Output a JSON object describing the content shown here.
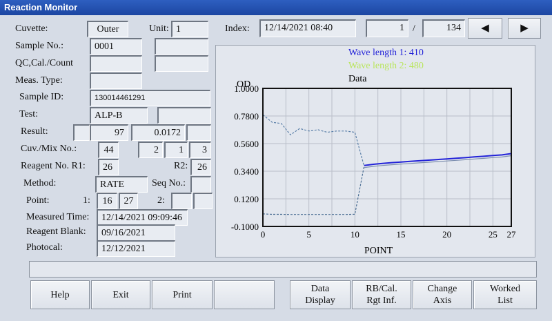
{
  "window": {
    "title": "Reaction Monitor"
  },
  "labels": {
    "cuvette": "Cuvette:",
    "unit": "Unit:",
    "index": "Index:",
    "sample_no": "Sample No.:",
    "qc": "QC,Cal./Count",
    "meas_type": "Meas. Type:",
    "sample_id": "Sample ID:",
    "test": "Test:",
    "result": "Result:",
    "cuv_mix": "Cuv./Mix No.:",
    "reagent_no": "Reagent No.  R1:",
    "r2": "R2:",
    "method": "Method:",
    "seq_no": "Seq No.:",
    "point": "Point:",
    "point_1": "1:",
    "point_2": "2:",
    "measured_time": "Measured Time:",
    "reagent_blank": "Reagent Blank:",
    "photocal": "Photocal:",
    "index_sep": "/"
  },
  "fields": {
    "cuvette": "Outer",
    "unit": "1",
    "index_datetime": "12/14/2021 08:40",
    "index_current": "1",
    "index_total": "134",
    "sample_no": "0001",
    "sample_no_extra": "",
    "qc_value": "",
    "qc_extra": "",
    "meas_type": "",
    "sample_id": "130014461291",
    "test": "ALP-B",
    "test_extra": "",
    "result_flag": "",
    "result_value": "97",
    "result_od": "0.0172",
    "result_extra": "",
    "cuv_no": "44",
    "mix_a": "2",
    "mix_b": "1",
    "mix_c": "3",
    "r1": "26",
    "r2": "26",
    "method": "RATE",
    "seq_no": "",
    "point1_start": "16",
    "point1_end": "27",
    "point2_start": "",
    "point2_end": "",
    "measured_time": "12/14/2021  09:09:46",
    "reagent_blank": "09/16/2021",
    "photocal": "12/12/2021"
  },
  "nav": {
    "prev_icon": "triangle-left-icon",
    "next_icon": "triangle-right-icon",
    "prev": "◀",
    "next": "▶"
  },
  "buttons": {
    "help": "Help",
    "exit": "Exit",
    "print": "Print",
    "blank": "",
    "data_display": "Data\nDisplay",
    "rb_cal": "RB/Cal.\nRgt Inf.",
    "change_axis": "Change\nAxis",
    "worked_list": "Worked\nList"
  },
  "status_text": "",
  "colors": {
    "wave1": "#2323d8",
    "wave2": "#b9e65c",
    "titlebar": "#1c46a2"
  },
  "chart_data": {
    "type": "line",
    "legend": [
      "Wave length 1: 410",
      "Wave length 2: 480",
      "Data"
    ],
    "ylabel": "OD",
    "xlabel": "POINT",
    "x_ticks": [
      0,
      5,
      10,
      15,
      20,
      25,
      27
    ],
    "y_ticks": [
      "1.0000",
      "0.7800",
      "0.5600",
      "0.3400",
      "0.1200",
      "-0.1000"
    ],
    "xlim": [
      0,
      27
    ],
    "ylim": [
      -0.1,
      1.0
    ],
    "grid": true,
    "series": [
      {
        "name": "Wave length 1: 410",
        "style": "dotted",
        "x": [
          0,
          1,
          2,
          3,
          4,
          5,
          6,
          7,
          8,
          9,
          10,
          11
        ],
        "y": [
          0.79,
          0.73,
          0.72,
          0.63,
          0.68,
          0.66,
          0.67,
          0.65,
          0.66,
          0.66,
          0.65,
          0.38
        ]
      },
      {
        "name": "Wave length 2: 480",
        "style": "dotted",
        "x": [
          0,
          1,
          2,
          3,
          4,
          5,
          6,
          7,
          8,
          9,
          10,
          11
        ],
        "y": [
          0.0,
          -0.004,
          -0.004,
          -0.005,
          -0.005,
          -0.005,
          -0.005,
          -0.005,
          -0.005,
          -0.005,
          -0.003,
          0.38
        ]
      },
      {
        "name": "Data",
        "style": "solid",
        "x": [
          11,
          12,
          13,
          14,
          15,
          16,
          17,
          18,
          19,
          20,
          21,
          22,
          23,
          24,
          25,
          26,
          27
        ],
        "y": [
          0.385,
          0.395,
          0.402,
          0.408,
          0.413,
          0.418,
          0.423,
          0.428,
          0.433,
          0.438,
          0.443,
          0.448,
          0.454,
          0.459,
          0.465,
          0.47,
          0.48
        ]
      }
    ]
  }
}
